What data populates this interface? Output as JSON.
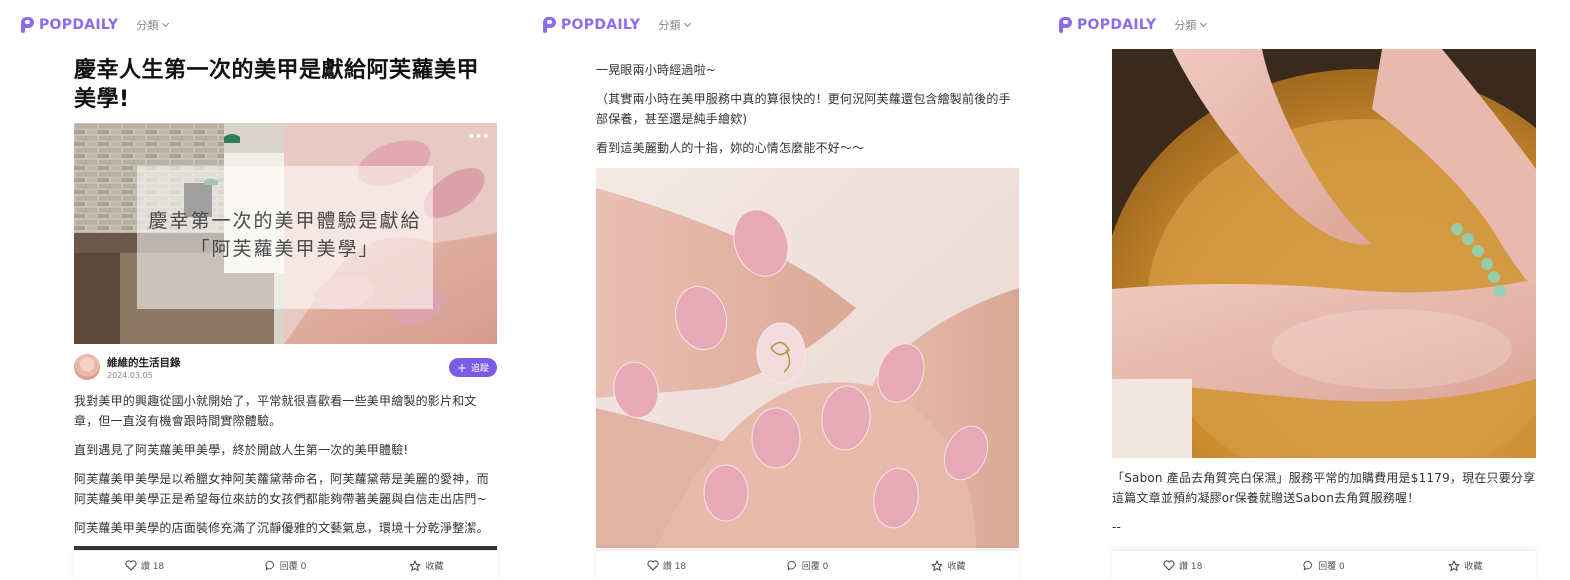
{
  "brand": {
    "logo_text": "POPDAILY",
    "category_label": "分類",
    "accent": "#8b6cf0"
  },
  "panel1": {
    "title": "慶幸人生第一次的美甲是獻給阿芙蘿美甲美學!",
    "cover_overlay": {
      "line1": "慶幸第一次的美甲體驗是獻給",
      "line2": "「阿芙蘿美甲美學」"
    },
    "author": {
      "name": "維維的生活目錄",
      "date": "2024.03.05",
      "follow_label": "追蹤"
    },
    "paragraphs": [
      "我對美甲的興趣從國小就開始了，平常就很喜歡看一些美甲繪製的影片和文章，但一直沒有機會跟時間實際體驗。",
      "直到遇見了阿芙蘿美甲美學，終於開啟人生第一次的美甲體驗!",
      "阿芙蘿美甲美學是以希臘女神阿芙蘿黛蒂命名，阿芙蘿黛蒂是美麗的愛神，而阿芙蘿美甲美學正是希望每位來訪的女孩們都能夠帶著美麗與自信走出店門~",
      "阿芙蘿美甲美學的店面裝修充滿了沉靜優雅的文藝氣息，環境十分乾淨整潔。"
    ]
  },
  "panel2": {
    "paragraphs": [
      "一晃眼兩小時經過啦~",
      "（其實兩小時在美甲服務中真的算很快的！更何況阿芙蘿還包含繪製前後的手部保養，甚至還是純手繪欸)",
      "看到這美麗動人的十指，妳的心情怎麼能不好～～"
    ]
  },
  "panel3": {
    "paragraphs": [
      "「Sabon 產品去角質亮白保濕」服務平常的加購費用是$1179，現在只要分享這篇文章並預約凝膠or保養就贈送Sabon去角質服務喔！",
      "--"
    ]
  },
  "actions": {
    "like_label": "讚 18",
    "reply_label": "回覆 0",
    "save_label": "收藏"
  }
}
